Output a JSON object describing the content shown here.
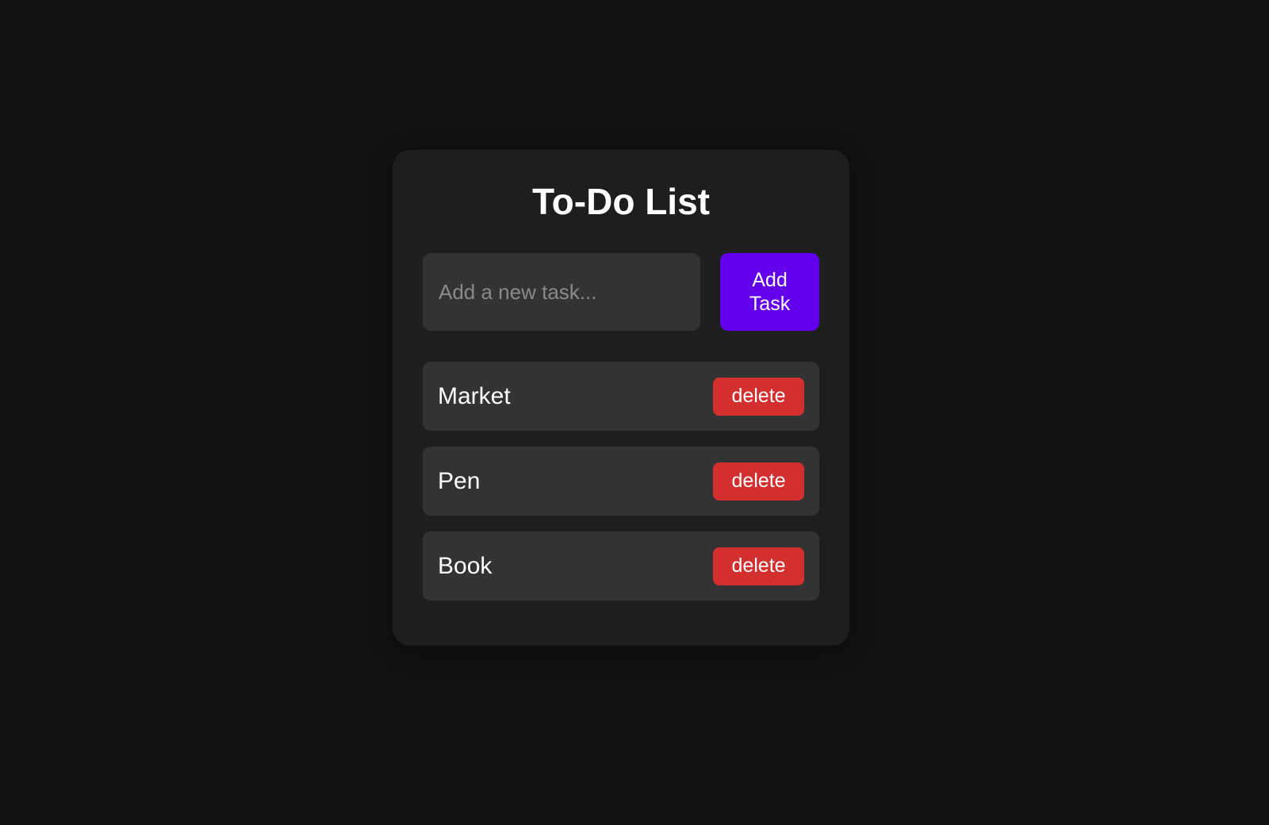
{
  "app": {
    "title": "To-Do List"
  },
  "input": {
    "placeholder": "Add a new task...",
    "value": ""
  },
  "add_button": {
    "label": "Add Task"
  },
  "tasks": [
    {
      "label": "Market",
      "delete_label": "delete"
    },
    {
      "label": "Pen",
      "delete_label": "delete"
    },
    {
      "label": "Book",
      "delete_label": "delete"
    }
  ],
  "colors": {
    "page_background": "#121212",
    "card_background": "#1e1e1e",
    "field_background": "#333333",
    "accent": "#6200ee",
    "danger": "#d32f2f",
    "text": "#ffffff",
    "placeholder": "#8a8a8a"
  }
}
